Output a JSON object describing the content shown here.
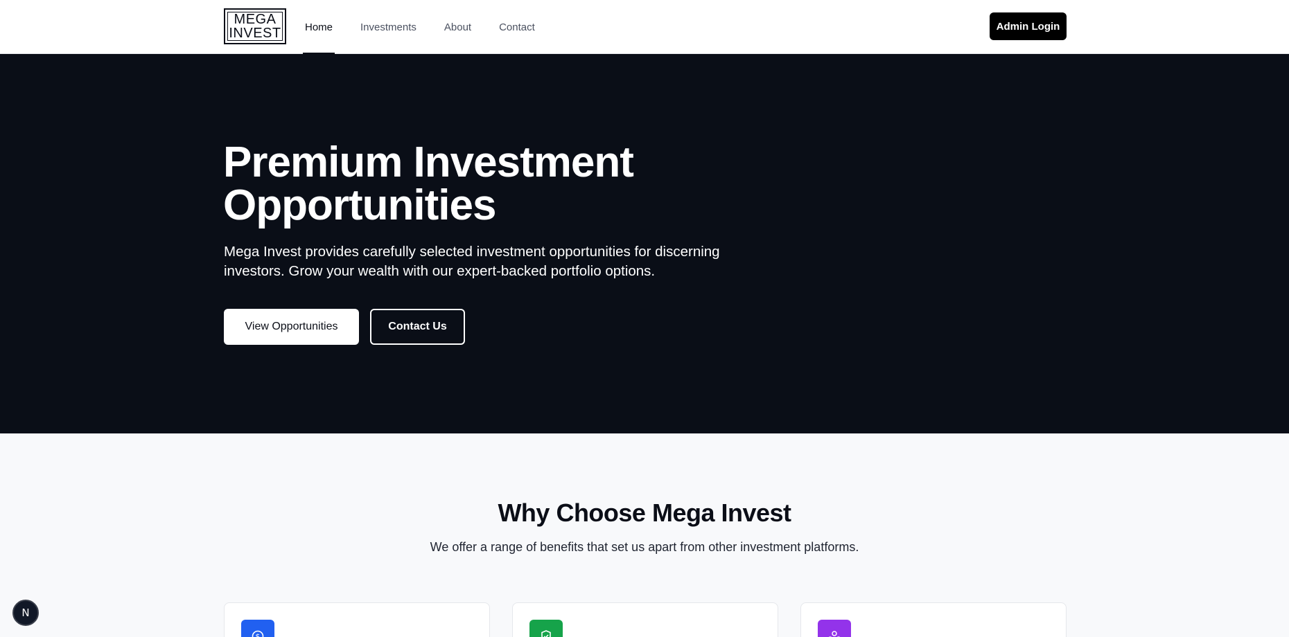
{
  "header": {
    "logo": {
      "line1": "MEGA",
      "line2": "INVEST"
    },
    "nav": [
      {
        "label": "Home",
        "active": true
      },
      {
        "label": "Investments",
        "active": false
      },
      {
        "label": "About",
        "active": false
      },
      {
        "label": "Contact",
        "active": false
      }
    ],
    "admin_login_label": "Admin Login"
  },
  "hero": {
    "title_line1": "Premium Investment",
    "title_line2": "Opportunities",
    "description_line1": "Mega Invest provides carefully selected investment opportunities for discerning",
    "description_line2": "investors. Grow your wealth with our expert-backed portfolio options.",
    "primary_button": "View Opportunities",
    "secondary_button": "Contact Us"
  },
  "features": {
    "title": "Why Choose Mega Invest",
    "subtitle": "We offer a range of benefits that set us apart from other investment platforms.",
    "cards": [
      {
        "icon": "dollar-icon",
        "color": "#2160f0"
      },
      {
        "icon": "shield-icon",
        "color": "#16a34a"
      },
      {
        "icon": "network-icon",
        "color": "#9333ea"
      }
    ]
  },
  "dev_badge": {
    "letter": "N"
  },
  "colors": {
    "hero_bg": "#0a0e17",
    "page_bg": "#f8f9fb",
    "accent_dark": "#000000"
  }
}
